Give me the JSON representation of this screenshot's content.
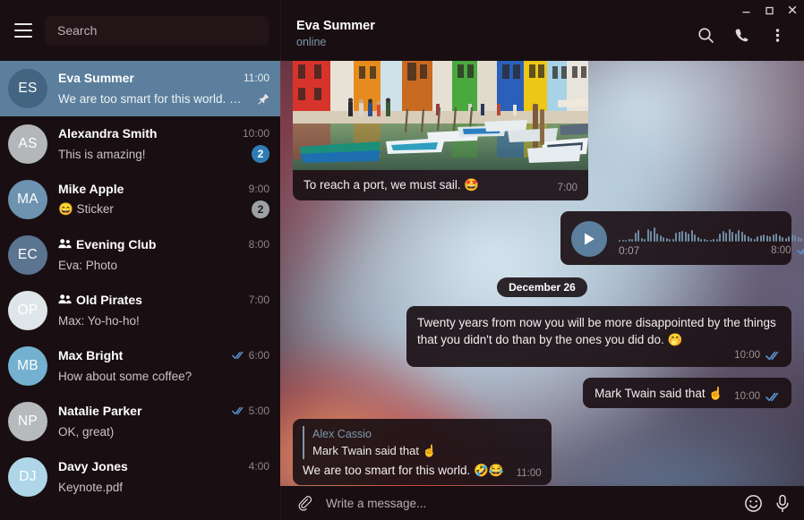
{
  "window": {
    "controls": [
      {
        "name": "minimize",
        "glyph": "minimize-icon"
      },
      {
        "name": "maximize",
        "glyph": "maximize-icon"
      },
      {
        "name": "close",
        "glyph": "close-icon"
      }
    ]
  },
  "sidebar": {
    "menu_icon": "hamburger-menu-icon",
    "search": {
      "placeholder": "Search",
      "value": ""
    },
    "chats": [
      {
        "avatar_initials": "ES",
        "avatar_color": "#436581",
        "name": "Eva Summer",
        "time": "11:00",
        "preview": "We are too smart for this world. …",
        "selected": true,
        "pinned": true,
        "is_group": false,
        "unread": null,
        "muted": false,
        "outgoing_ticks": false
      },
      {
        "avatar_initials": "AS",
        "avatar_color": "#b3b7ba",
        "name": "Alexandra Smith",
        "time": "10:00",
        "preview": "This is amazing!",
        "selected": false,
        "pinned": false,
        "is_group": false,
        "unread": "2",
        "muted": false,
        "outgoing_ticks": false
      },
      {
        "avatar_initials": "MA",
        "avatar_color": "#6e93b0",
        "name": "Mike Apple",
        "time": "9:00",
        "preview": "😄 Sticker",
        "selected": false,
        "pinned": false,
        "is_group": false,
        "unread": "2",
        "muted": true,
        "outgoing_ticks": false
      },
      {
        "avatar_initials": "EC",
        "avatar_color": "#5b7590",
        "name": "Evening Club",
        "time": "8:00",
        "preview": "Eva: Photo",
        "selected": false,
        "pinned": false,
        "is_group": true,
        "unread": null,
        "muted": false,
        "outgoing_ticks": false
      },
      {
        "avatar_initials": "OP",
        "avatar_color": "#dfe6ea",
        "name": "Old Pirates",
        "time": "7:00",
        "preview": "Max: Yo-ho-ho!",
        "selected": false,
        "pinned": false,
        "is_group": true,
        "unread": null,
        "muted": false,
        "outgoing_ticks": false
      },
      {
        "avatar_initials": "MB",
        "avatar_color": "#74b1d0",
        "name": "Max Bright",
        "time": "6:00",
        "preview": "How about some coffee?",
        "selected": false,
        "pinned": false,
        "is_group": false,
        "unread": null,
        "muted": false,
        "outgoing_ticks": true
      },
      {
        "avatar_initials": "NP",
        "avatar_color": "#b6babd",
        "name": "Natalie Parker",
        "time": "5:00",
        "preview": "OK, great)",
        "selected": false,
        "pinned": false,
        "is_group": false,
        "unread": null,
        "muted": false,
        "outgoing_ticks": true
      },
      {
        "avatar_initials": "DJ",
        "avatar_color": "#aed6e8",
        "name": "Davy Jones",
        "time": "4:00",
        "preview": "Keynote.pdf",
        "selected": false,
        "pinned": false,
        "is_group": false,
        "unread": null,
        "muted": false,
        "outgoing_ticks": false
      }
    ]
  },
  "chat_header": {
    "title": "Eva Summer",
    "status": "online",
    "actions": [
      {
        "name": "search-icon",
        "label": "Search"
      },
      {
        "name": "phone-icon",
        "label": "Call"
      },
      {
        "name": "more-vertical-icon",
        "label": "More"
      }
    ]
  },
  "messages": {
    "photo_message": {
      "caption": "To reach a port, we must sail. 🤩",
      "time": "7:00",
      "direction": "in"
    },
    "voice_message": {
      "duration": "0:07",
      "time": "8:00",
      "direction": "out",
      "read": true,
      "play_icon": "play-icon"
    },
    "date_divider": "December 26",
    "quote_message": {
      "text": "Twenty years from now you will be more disappointed by the things that you didn't do than by the ones you did do. 🤭",
      "time": "10:00",
      "direction": "out",
      "read": true
    },
    "attribution_message": {
      "text": "Mark Twain said that ☝️",
      "time": "10:00",
      "direction": "out",
      "read": true
    },
    "reply_message": {
      "reply_to_name": "Alex Cassio",
      "reply_to_text": "Mark Twain said that ☝️",
      "text": "We are too smart for this world. 🤣😂",
      "time": "11:00",
      "direction": "in"
    }
  },
  "composer": {
    "attach_icon": "paperclip-icon",
    "placeholder": "Write a message...",
    "value": "",
    "emoji_icon": "smiley-icon",
    "mic_icon": "microphone-icon"
  },
  "colors": {
    "accent": "#2f7cb4",
    "selected_row": "#5b7f9c",
    "tick_read": "#5b8fc9",
    "link_name": "#7e97ab",
    "background": "#190f12"
  },
  "chart_data": null
}
